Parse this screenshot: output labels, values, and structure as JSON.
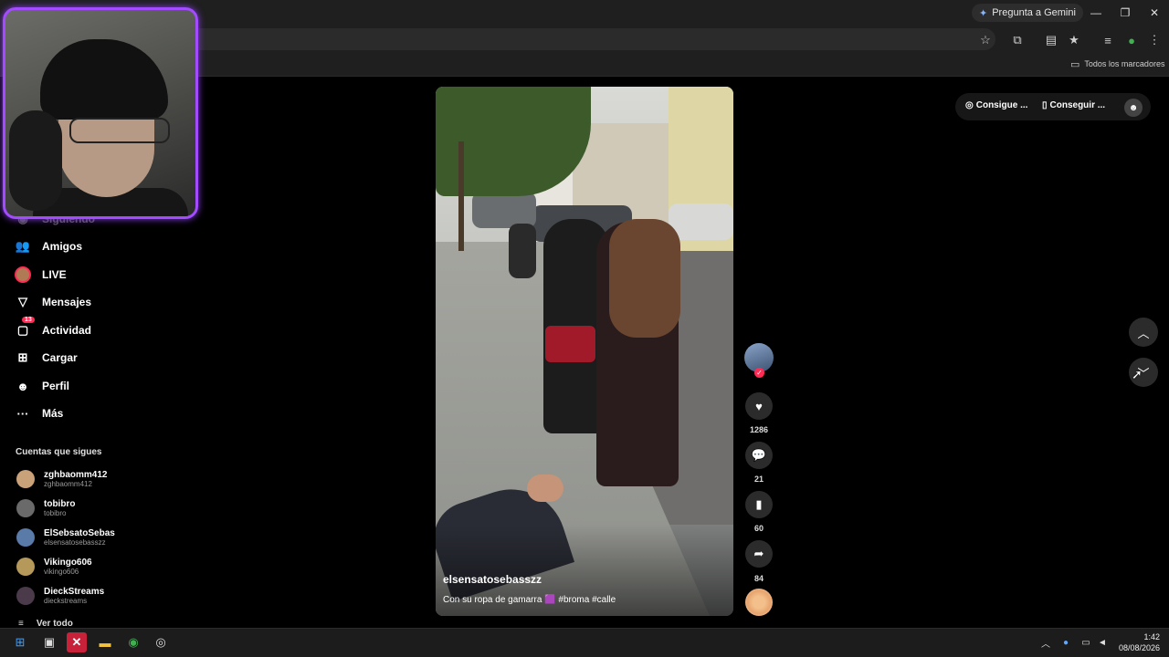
{
  "browser": {
    "gemini_label": "Pregunta a Gemini",
    "bookmarks_label": "Todos los marcadores",
    "minimize": "—",
    "restore": "❐",
    "close": "✕",
    "icons": [
      "star-icon",
      "extensions-icon",
      "sidepanel-icon",
      "bookmark-star-icon",
      "media-icon",
      "profile-icon",
      "menu-icon"
    ]
  },
  "sidebar": {
    "partial_item": "Siguiendo",
    "items": [
      {
        "label": "Amigos",
        "icon": "friends-icon"
      },
      {
        "label": "LIVE",
        "icon": "live-icon"
      },
      {
        "label": "Mensajes",
        "icon": "messages-icon"
      },
      {
        "label": "Actividad",
        "icon": "activity-icon",
        "badge": "13"
      },
      {
        "label": "Cargar",
        "icon": "upload-icon"
      },
      {
        "label": "Perfil",
        "icon": "profile-icon"
      },
      {
        "label": "Más",
        "icon": "more-icon"
      }
    ],
    "following_title": "Cuentas que sigues",
    "accounts": [
      {
        "name": "zghbaomm412",
        "user": "zghbaomm412",
        "color": "#c9a27a"
      },
      {
        "name": "tobibro",
        "user": "tobibro",
        "color": "#6a6a6a"
      },
      {
        "name": "ElSebsatoSebas",
        "user": "elsensatosebasszz",
        "color": "#5a7aa8"
      },
      {
        "name": "Vikingo606",
        "user": "vikingo606",
        "color": "#b5995b"
      },
      {
        "name": "DieckStreams",
        "user": "dieckstreams",
        "color": "#4a3a4a"
      }
    ],
    "see_all": "Ver todo"
  },
  "video": {
    "username": "elsensatosebasszz",
    "description": "Con su ropa de gamarra 🟪 #broma #calle"
  },
  "actions": {
    "likes": "1286",
    "comments": "21",
    "saves": "60",
    "shares": "84"
  },
  "topright": {
    "coins": "Consigue ...",
    "app": "Conseguir ..."
  },
  "taskbar": {
    "time": "1:42",
    "date": "08/08/2026"
  }
}
